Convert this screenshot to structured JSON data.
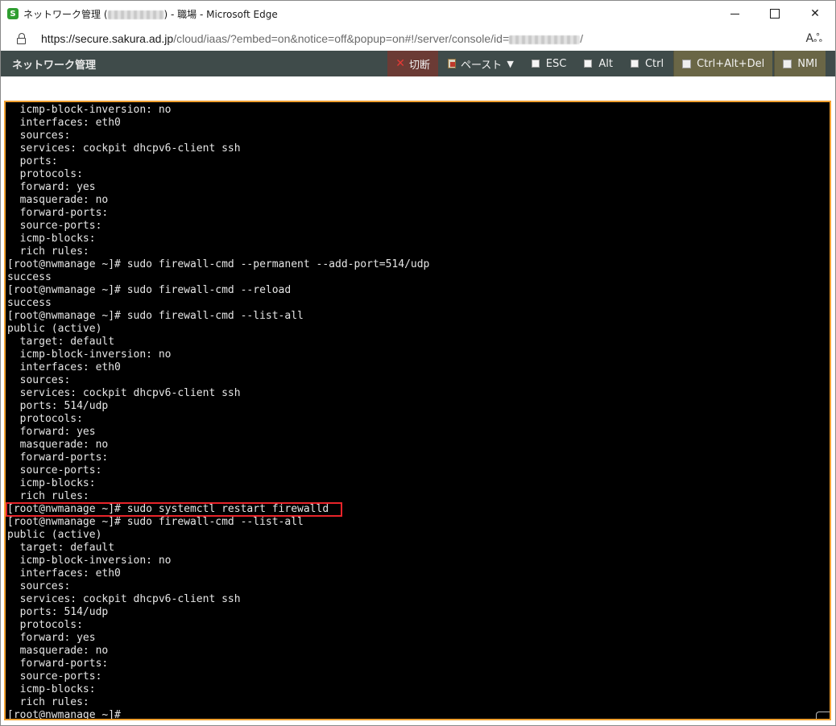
{
  "window": {
    "title_prefix": "ネットワーク管理 (",
    "title_suffix": ") - 職場 - Microsoft Edge",
    "app_icon_glyph": "S",
    "minimize_label": "",
    "maximize_label": "",
    "close_label": "✕"
  },
  "address_bar": {
    "url_host": "https://secure.sakura.ad.jp",
    "url_path": "/cloud/iaas/?embed=on&notice=off&popup=on#!/server/console/id=",
    "url_tail": "/",
    "read_aloud_glyph": "Aஃ"
  },
  "toolbar": {
    "title": "ネットワーク管理",
    "buttons": {
      "disconnect": "切断",
      "paste": "ペースト",
      "paste_caret": "▼",
      "esc": "ESC",
      "alt": "Alt",
      "ctrl": "Ctrl",
      "ctrl_alt_del": "Ctrl+Alt+Del",
      "nmi": "NMI"
    },
    "colors": {
      "bar": "#3f4b4a",
      "disconnect_bg": "#6b3b35",
      "combo_bg": "#6a6646",
      "disconnect_icon": "#e53935"
    }
  },
  "console": {
    "border_color": "#f0a030",
    "highlight_color": "#e8242a",
    "highlighted_line_index": 31,
    "lines": [
      "  icmp-block-inversion: no",
      "  interfaces: eth0",
      "  sources:",
      "  services: cockpit dhcpv6-client ssh",
      "  ports:",
      "  protocols:",
      "  forward: yes",
      "  masquerade: no",
      "  forward-ports:",
      "  source-ports:",
      "  icmp-blocks:",
      "  rich rules:",
      "[root@nwmanage ~]# sudo firewall-cmd --permanent --add-port=514/udp",
      "success",
      "[root@nwmanage ~]# sudo firewall-cmd --reload",
      "success",
      "[root@nwmanage ~]# sudo firewall-cmd --list-all",
      "public (active)",
      "  target: default",
      "  icmp-block-inversion: no",
      "  interfaces: eth0",
      "  sources:",
      "  services: cockpit dhcpv6-client ssh",
      "  ports: 514/udp",
      "  protocols:",
      "  forward: yes",
      "  masquerade: no",
      "  forward-ports:",
      "  source-ports:",
      "  icmp-blocks:",
      "  rich rules:",
      "[root@nwmanage ~]# sudo systemctl restart firewalld",
      "[root@nwmanage ~]# sudo firewall-cmd --list-all",
      "public (active)",
      "  target: default",
      "  icmp-block-inversion: no",
      "  interfaces: eth0",
      "  sources:",
      "  services: cockpit dhcpv6-client ssh",
      "  ports: 514/udp",
      "  protocols:",
      "  forward: yes",
      "  masquerade: no",
      "  forward-ports:",
      "  source-ports:",
      "  icmp-blocks:",
      "  rich rules:",
      "[root@nwmanage ~]#"
    ]
  }
}
